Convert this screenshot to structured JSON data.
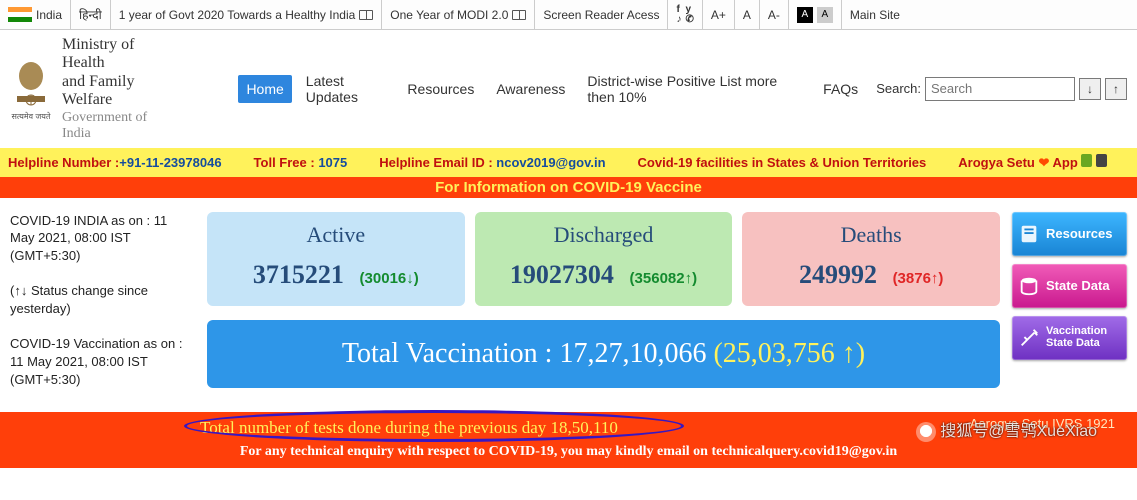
{
  "util": {
    "country": "India",
    "lang": "हिन्दी",
    "link1": "1 year of Govt 2020 Towards a Healthy India",
    "link2": "One Year of MODI 2.0",
    "reader": "Screen Reader Acess",
    "font_plus": "A+",
    "font_norm": "A",
    "font_minus": "A-",
    "theme_a": "A",
    "theme_b": "A",
    "main_site": "Main Site"
  },
  "ministry": {
    "line1": "Ministry of Health",
    "line2": "and Family Welfare",
    "line3": "Government of India",
    "emblem_caption": "सत्यमेव जयते"
  },
  "nav": {
    "home": "Home",
    "updates": "Latest Updates",
    "resources": "Resources",
    "awareness": "Awareness",
    "district": "District-wise Positive List more then 10%",
    "faqs": "FAQs",
    "search_label": "Search:",
    "search_placeholder": "Search",
    "sort_down": "↓",
    "sort_up": "↑"
  },
  "help": {
    "helpline_k": "Helpline Number :",
    "helpline_v": "+91-11-23978046",
    "toll_k": "Toll Free :",
    "toll_v": "1075",
    "email_k": "Helpline Email ID :",
    "email_v": "ncov2019@gov.in",
    "facilities": "Covid-19 facilities in States & Union Territories",
    "arogya_k": "Arogya Setu",
    "arogya_v": "App"
  },
  "banner1": "For Information on COVID-19 Vaccine",
  "left": {
    "asof": "COVID-19 INDIA as on : 11 May 2021, 08:00 IST (GMT+5:30)",
    "note": "(↑↓ Status change since yesterday)",
    "vacc": "COVID-19 Vaccination as on : 11 May 2021, 08:00 IST (GMT+5:30)"
  },
  "cards": {
    "active": {
      "title": "Active",
      "value": "3715221",
      "delta": "(30016↓)"
    },
    "discharged": {
      "title": "Discharged",
      "value": "19027304",
      "delta": "(356082↑)"
    },
    "deaths": {
      "title": "Deaths",
      "value": "249992",
      "delta": "(3876↑)"
    }
  },
  "vacc_card": {
    "label": "Total Vaccination :",
    "value": "17,27,10,066",
    "delta": "(25,03,756 ↑)"
  },
  "side": {
    "resources": "Resources",
    "state": "State Data",
    "vacc_state": "Vaccination State Data"
  },
  "bottom": {
    "tests": "Total number of tests done during the previous day 18,50,110",
    "tech": "For any technical enquiry with respect to COVID-19, you may kindly email on technicalquery.covid19@gov.in",
    "ivrs": "Aarogya Setu IVRS   1921"
  },
  "watermark": "搜狐号@雪鸮XueXiao"
}
